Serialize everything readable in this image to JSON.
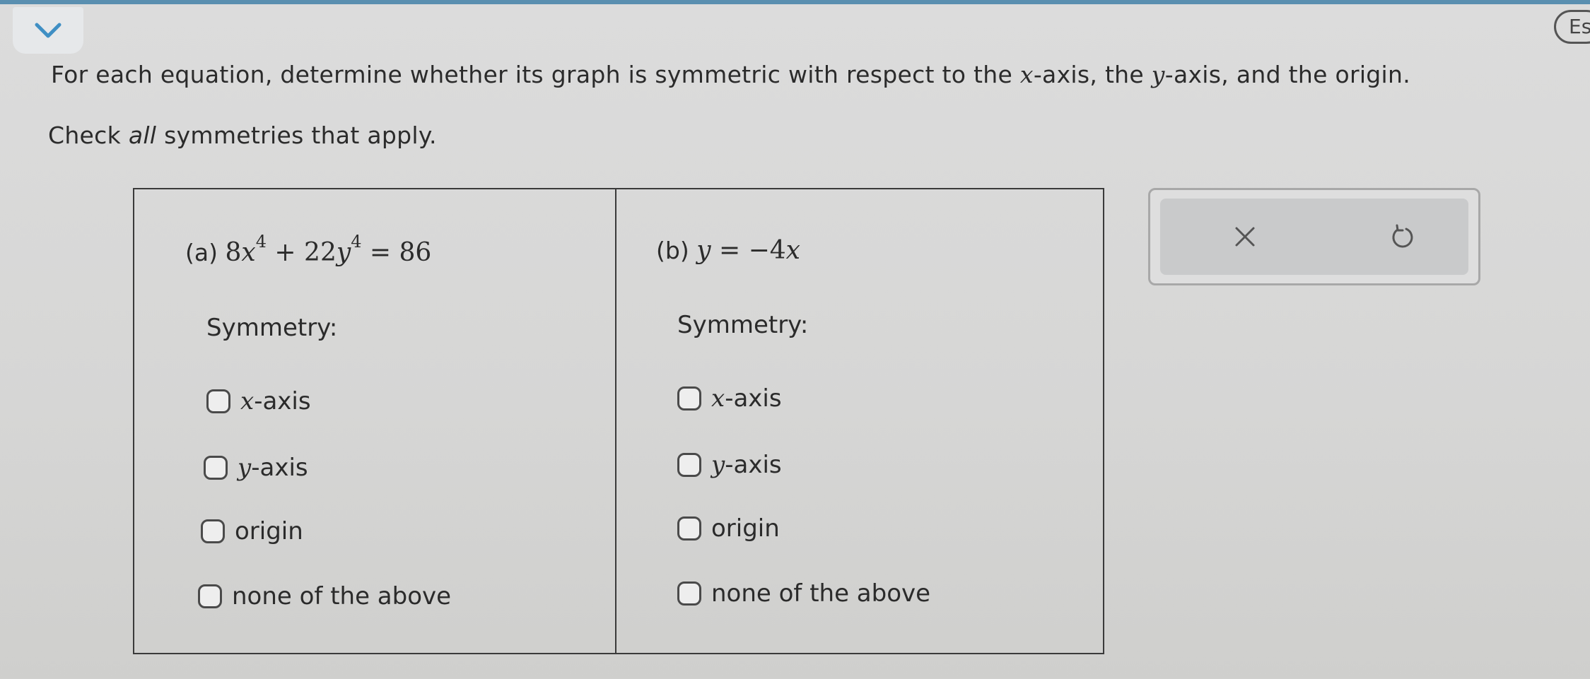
{
  "header": {
    "collapse_icon": "chevron-down-icon",
    "language_badge": "Es"
  },
  "question": {
    "prefix": "For each equation, determine whether its graph is symmetric with respect to the ",
    "x_var": "x",
    "mid1": "-axis, the ",
    "y_var": "y",
    "mid2": "-axis, and the origin."
  },
  "instruction": {
    "pre": "Check ",
    "emphasis": "all",
    "post": " symmetries that apply."
  },
  "part_a": {
    "label": "(a)",
    "equation": {
      "t1": "8",
      "v1": "x",
      "e1": "4",
      "t2": " + 22",
      "v2": "y",
      "e2": "4",
      "t3": " = 86"
    },
    "symmetry_label": "Symmetry:",
    "options": [
      {
        "var": "x",
        "text": "-axis",
        "checked": false
      },
      {
        "var": "y",
        "text": "-axis",
        "checked": false
      },
      {
        "var": "",
        "text": "origin",
        "checked": false
      },
      {
        "var": "",
        "text": "none of the above",
        "checked": false
      }
    ]
  },
  "part_b": {
    "label": "(b)",
    "equation": {
      "v1": "y",
      "t1": " = −4",
      "v2": "x"
    },
    "symmetry_label": "Symmetry:",
    "options": [
      {
        "var": "x",
        "text": "-axis",
        "checked": false
      },
      {
        "var": "y",
        "text": "-axis",
        "checked": false
      },
      {
        "var": "",
        "text": "origin",
        "checked": false
      },
      {
        "var": "",
        "text": "none of the above",
        "checked": false
      }
    ]
  },
  "tools": {
    "clear_icon": "close-icon",
    "undo_icon": "undo-icon"
  },
  "colors": {
    "accent_strip": "#5a8fb0",
    "border": "#3a3a3a"
  }
}
